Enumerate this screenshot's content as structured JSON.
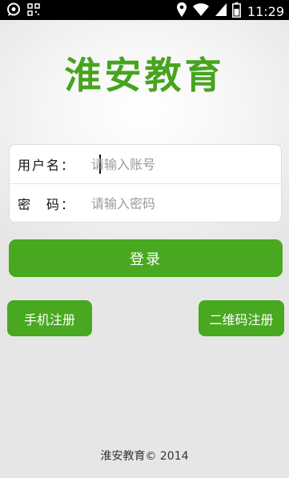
{
  "status_bar": {
    "time": "11:29",
    "left_icons": [
      "chat-bubble-icon",
      "grid-app-icon"
    ],
    "right_icons": [
      "location-icon",
      "wifi-icon",
      "signal-icon",
      "battery-icon"
    ]
  },
  "app": {
    "title": "淮安教育",
    "accent_color": "#48a820"
  },
  "login_form": {
    "username_label": "用户名：",
    "username_placeholder": "请输入账号",
    "username_value": "",
    "password_label": "密　码：",
    "password_placeholder": "请输入密码",
    "password_value": ""
  },
  "buttons": {
    "login": "登录",
    "phone_register": "手机注册",
    "qr_register": "二维码注册"
  },
  "footer": {
    "copyright": "淮安教育© 2014"
  }
}
